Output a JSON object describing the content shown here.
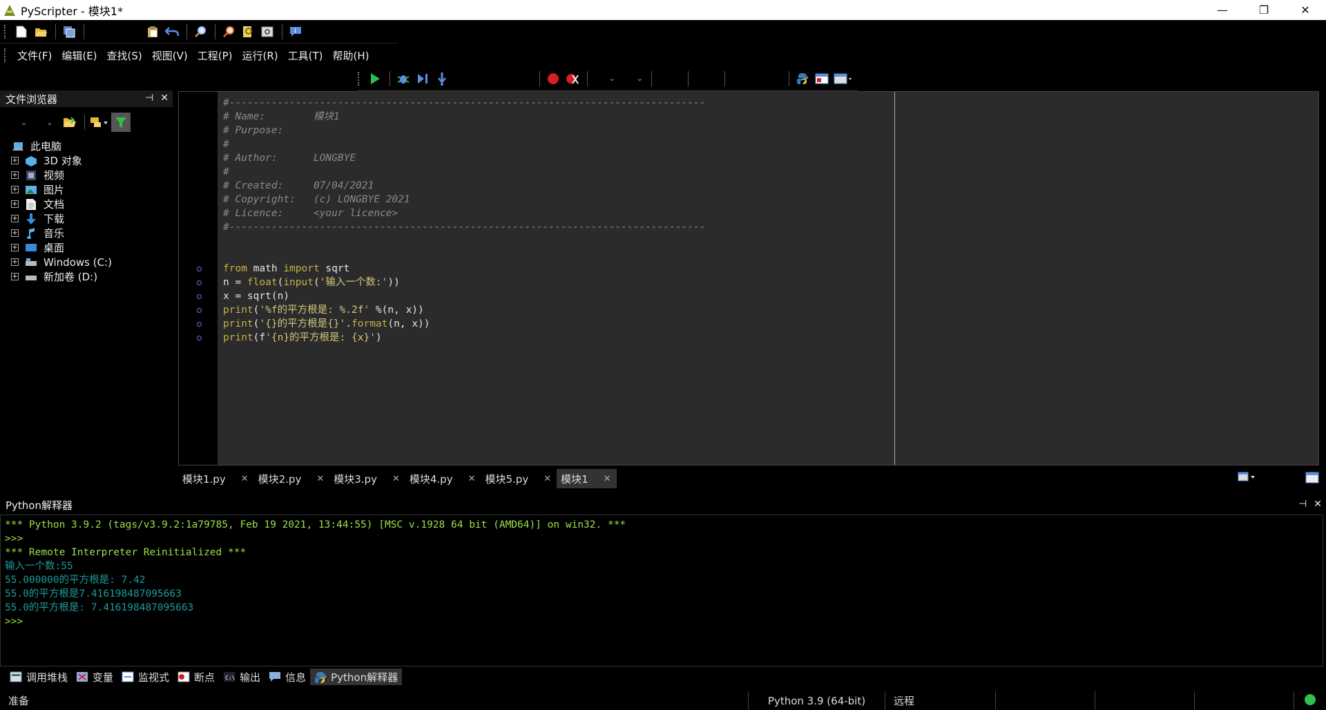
{
  "window": {
    "title": "PyScripter - 模块1*",
    "minimize": "—",
    "maximize": "❐",
    "close": "✕"
  },
  "menu": [
    "文件(F)",
    "编辑(E)",
    "查找(S)",
    "视图(V)",
    "工程(P)",
    "运行(R)",
    "工具(T)",
    "帮助(H)"
  ],
  "file_browser": {
    "title": "文件浏览器",
    "root": "此电脑",
    "items": [
      "3D 对象",
      "视频",
      "图片",
      "文档",
      "下载",
      "音乐",
      "桌面",
      "Windows (C:)",
      "新加卷 (D:)"
    ]
  },
  "editor": {
    "header": [
      "#-------------------------------------------------------------------------------",
      "# Name:        模块1",
      "# Purpose:",
      "#",
      "# Author:      LONGBYE",
      "#",
      "# Created:     07/04/2021",
      "# Copyright:   (c) LONGBYE 2021",
      "# Licence:     <your licence>",
      "#-------------------------------------------------------------------------------"
    ],
    "code": [
      "from math import sqrt",
      "n = float(input('输入一个数:'))",
      "x = sqrt(n)",
      "print('%f的平方根是: %.2f' %(n, x))",
      "print('{}的平方根是{}'.format(n, x))",
      "print(f'{n}的平方根是: {x}')"
    ]
  },
  "editor_tabs": [
    {
      "label": "模块1.py",
      "close": "✕"
    },
    {
      "label": "模块2.py",
      "close": "✕"
    },
    {
      "label": "模块3.py",
      "close": "✕"
    },
    {
      "label": "模块4.py",
      "close": "✕"
    },
    {
      "label": "模块5.py",
      "close": "✕"
    },
    {
      "label": "模块1",
      "close": "✕"
    }
  ],
  "interpreter": {
    "title": "Python解释器",
    "lines": [
      "*** Python 3.9.2 (tags/v3.9.2:1a79785, Feb 19 2021, 13:44:55) [MSC v.1928 64 bit (AMD64)] on win32. ***",
      ">>>",
      "*** Remote Interpreter Reinitialized ***",
      "输入一个数:55",
      "55.000000的平方根是: 7.42",
      "55.0的平方根是7.416198487095663",
      "55.0的平方根是: 7.416198487095663",
      ">>>"
    ]
  },
  "bottom_tabs": [
    "调用堆栈",
    "变量",
    "监视式",
    "断点",
    "输出",
    "信息",
    "Python解释器"
  ],
  "status": {
    "ready": "准备",
    "python_version": "Python 3.9 (64-bit)",
    "remote": "远程"
  },
  "panel_buttons": {
    "pin": "⊣",
    "close": "✕"
  }
}
